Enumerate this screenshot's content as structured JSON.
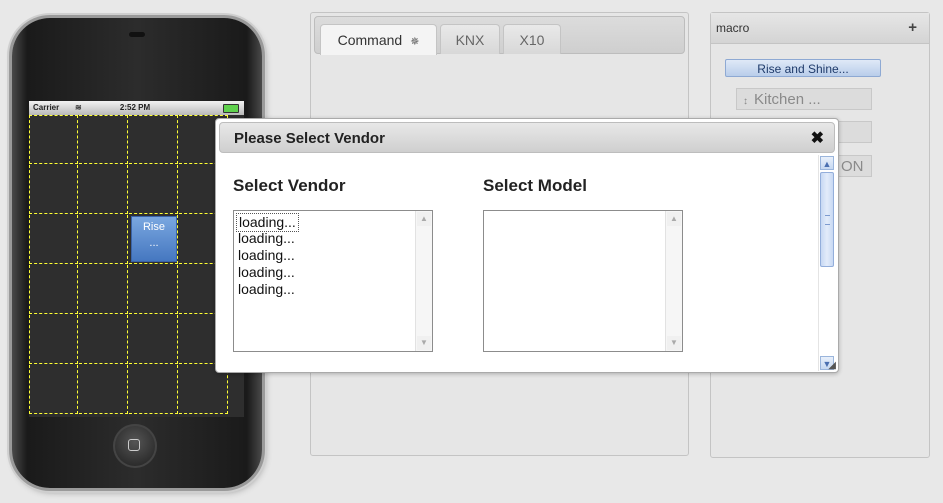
{
  "phone": {
    "carrier": "Carrier",
    "time": "2:52 PM",
    "button_line1": "Rise",
    "button_line2": "..."
  },
  "tabs": [
    {
      "label": "Command",
      "active": true
    },
    {
      "label": "KNX",
      "active": false
    },
    {
      "label": "X10",
      "active": false
    }
  ],
  "macro": {
    "title": "macro",
    "add_icon": "+",
    "items": [
      {
        "label": "Rise and Shine..."
      },
      {
        "label": "Kitchen ..."
      },
      {
        "label": ""
      },
      {
        "label": "ON"
      }
    ]
  },
  "dialog": {
    "title": "Please Select Vendor",
    "close_icon": "✖",
    "vendor_label": "Select Vendor",
    "model_label": "Select Model",
    "vendor_items": [
      "loading...",
      "loading...",
      "loading...",
      "loading...",
      "loading..."
    ],
    "model_items": []
  },
  "colors": {
    "accent": "#4a7cc4",
    "grid_line": "#ffff33",
    "selection": "#b9cdea"
  }
}
